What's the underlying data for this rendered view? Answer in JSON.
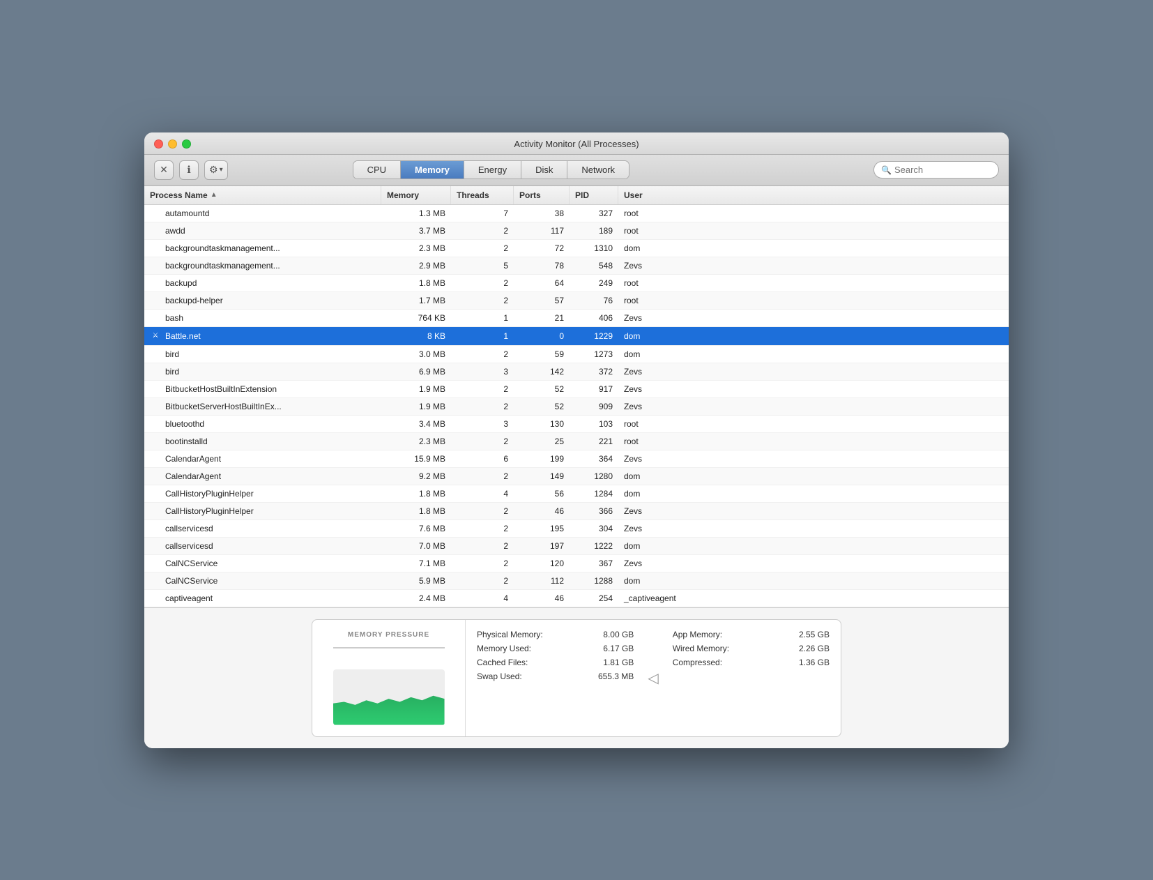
{
  "window": {
    "title": "Activity Monitor (All Processes)"
  },
  "toolbar": {
    "close_label": "✕",
    "info_label": "ℹ",
    "gear_label": "⚙",
    "chevron_label": "▾",
    "search_placeholder": "Search"
  },
  "tabs": [
    {
      "id": "cpu",
      "label": "CPU",
      "active": false
    },
    {
      "id": "memory",
      "label": "Memory",
      "active": true
    },
    {
      "id": "energy",
      "label": "Energy",
      "active": false
    },
    {
      "id": "disk",
      "label": "Disk",
      "active": false
    },
    {
      "id": "network",
      "label": "Network",
      "active": false
    }
  ],
  "table": {
    "columns": [
      {
        "id": "process-name",
        "label": "Process Name",
        "sortable": true,
        "sort": "asc"
      },
      {
        "id": "memory",
        "label": "Memory",
        "sortable": true
      },
      {
        "id": "threads",
        "label": "Threads",
        "sortable": true
      },
      {
        "id": "ports",
        "label": "Ports",
        "sortable": true
      },
      {
        "id": "pid",
        "label": "PID",
        "sortable": true
      },
      {
        "id": "user",
        "label": "User",
        "sortable": true
      }
    ],
    "rows": [
      {
        "name": "autamountd",
        "memory": "1.3 MB",
        "threads": "7",
        "ports": "38",
        "pid": "327",
        "user": "root",
        "selected": false,
        "hasIcon": false
      },
      {
        "name": "awdd",
        "memory": "3.7 MB",
        "threads": "2",
        "ports": "117",
        "pid": "189",
        "user": "root",
        "selected": false,
        "hasIcon": false
      },
      {
        "name": "backgroundtaskmanagement...",
        "memory": "2.3 MB",
        "threads": "2",
        "ports": "72",
        "pid": "1310",
        "user": "dom",
        "selected": false,
        "hasIcon": false
      },
      {
        "name": "backgroundtaskmanagement...",
        "memory": "2.9 MB",
        "threads": "5",
        "ports": "78",
        "pid": "548",
        "user": "Zevs",
        "selected": false,
        "hasIcon": false
      },
      {
        "name": "backupd",
        "memory": "1.8 MB",
        "threads": "2",
        "ports": "64",
        "pid": "249",
        "user": "root",
        "selected": false,
        "hasIcon": false
      },
      {
        "name": "backupd-helper",
        "memory": "1.7 MB",
        "threads": "2",
        "ports": "57",
        "pid": "76",
        "user": "root",
        "selected": false,
        "hasIcon": false
      },
      {
        "name": "bash",
        "memory": "764 KB",
        "threads": "1",
        "ports": "21",
        "pid": "406",
        "user": "Zevs",
        "selected": false,
        "hasIcon": false
      },
      {
        "name": "Battle.net",
        "memory": "8 KB",
        "threads": "1",
        "ports": "0",
        "pid": "1229",
        "user": "dom",
        "selected": true,
        "hasIcon": true
      },
      {
        "name": "bird",
        "memory": "3.0 MB",
        "threads": "2",
        "ports": "59",
        "pid": "1273",
        "user": "dom",
        "selected": false,
        "hasIcon": false
      },
      {
        "name": "bird",
        "memory": "6.9 MB",
        "threads": "3",
        "ports": "142",
        "pid": "372",
        "user": "Zevs",
        "selected": false,
        "hasIcon": false
      },
      {
        "name": "BitbucketHostBuiltInExtension",
        "memory": "1.9 MB",
        "threads": "2",
        "ports": "52",
        "pid": "917",
        "user": "Zevs",
        "selected": false,
        "hasIcon": false
      },
      {
        "name": "BitbucketServerHostBuiltInEx...",
        "memory": "1.9 MB",
        "threads": "2",
        "ports": "52",
        "pid": "909",
        "user": "Zevs",
        "selected": false,
        "hasIcon": false
      },
      {
        "name": "bluetoothd",
        "memory": "3.4 MB",
        "threads": "3",
        "ports": "130",
        "pid": "103",
        "user": "root",
        "selected": false,
        "hasIcon": false
      },
      {
        "name": "bootinstalld",
        "memory": "2.3 MB",
        "threads": "2",
        "ports": "25",
        "pid": "221",
        "user": "root",
        "selected": false,
        "hasIcon": false
      },
      {
        "name": "CalendarAgent",
        "memory": "15.9 MB",
        "threads": "6",
        "ports": "199",
        "pid": "364",
        "user": "Zevs",
        "selected": false,
        "hasIcon": false
      },
      {
        "name": "CalendarAgent",
        "memory": "9.2 MB",
        "threads": "2",
        "ports": "149",
        "pid": "1280",
        "user": "dom",
        "selected": false,
        "hasIcon": false
      },
      {
        "name": "CallHistoryPluginHelper",
        "memory": "1.8 MB",
        "threads": "4",
        "ports": "56",
        "pid": "1284",
        "user": "dom",
        "selected": false,
        "hasIcon": false
      },
      {
        "name": "CallHistoryPluginHelper",
        "memory": "1.8 MB",
        "threads": "2",
        "ports": "46",
        "pid": "366",
        "user": "Zevs",
        "selected": false,
        "hasIcon": false
      },
      {
        "name": "callservicesd",
        "memory": "7.6 MB",
        "threads": "2",
        "ports": "195",
        "pid": "304",
        "user": "Zevs",
        "selected": false,
        "hasIcon": false
      },
      {
        "name": "callservicesd",
        "memory": "7.0 MB",
        "threads": "2",
        "ports": "197",
        "pid": "1222",
        "user": "dom",
        "selected": false,
        "hasIcon": false
      },
      {
        "name": "CalNCService",
        "memory": "7.1 MB",
        "threads": "2",
        "ports": "120",
        "pid": "367",
        "user": "Zevs",
        "selected": false,
        "hasIcon": false
      },
      {
        "name": "CalNCService",
        "memory": "5.9 MB",
        "threads": "2",
        "ports": "112",
        "pid": "1288",
        "user": "dom",
        "selected": false,
        "hasIcon": false
      },
      {
        "name": "captiveagent",
        "memory": "2.4 MB",
        "threads": "4",
        "ports": "46",
        "pid": "254",
        "user": "_captiveagent",
        "selected": false,
        "hasIcon": false
      }
    ]
  },
  "stats": {
    "memory_pressure_label": "MEMORY PRESSURE",
    "physical_memory_label": "Physical Memory:",
    "physical_memory_value": "8.00 GB",
    "memory_used_label": "Memory Used:",
    "memory_used_value": "6.17 GB",
    "cached_files_label": "Cached Files:",
    "cached_files_value": "1.81 GB",
    "swap_used_label": "Swap Used:",
    "swap_used_value": "655.3 MB",
    "app_memory_label": "App Memory:",
    "app_memory_value": "2.55 GB",
    "wired_memory_label": "Wired Memory:",
    "wired_memory_value": "2.26 GB",
    "compressed_label": "Compressed:",
    "compressed_value": "1.36 GB"
  }
}
